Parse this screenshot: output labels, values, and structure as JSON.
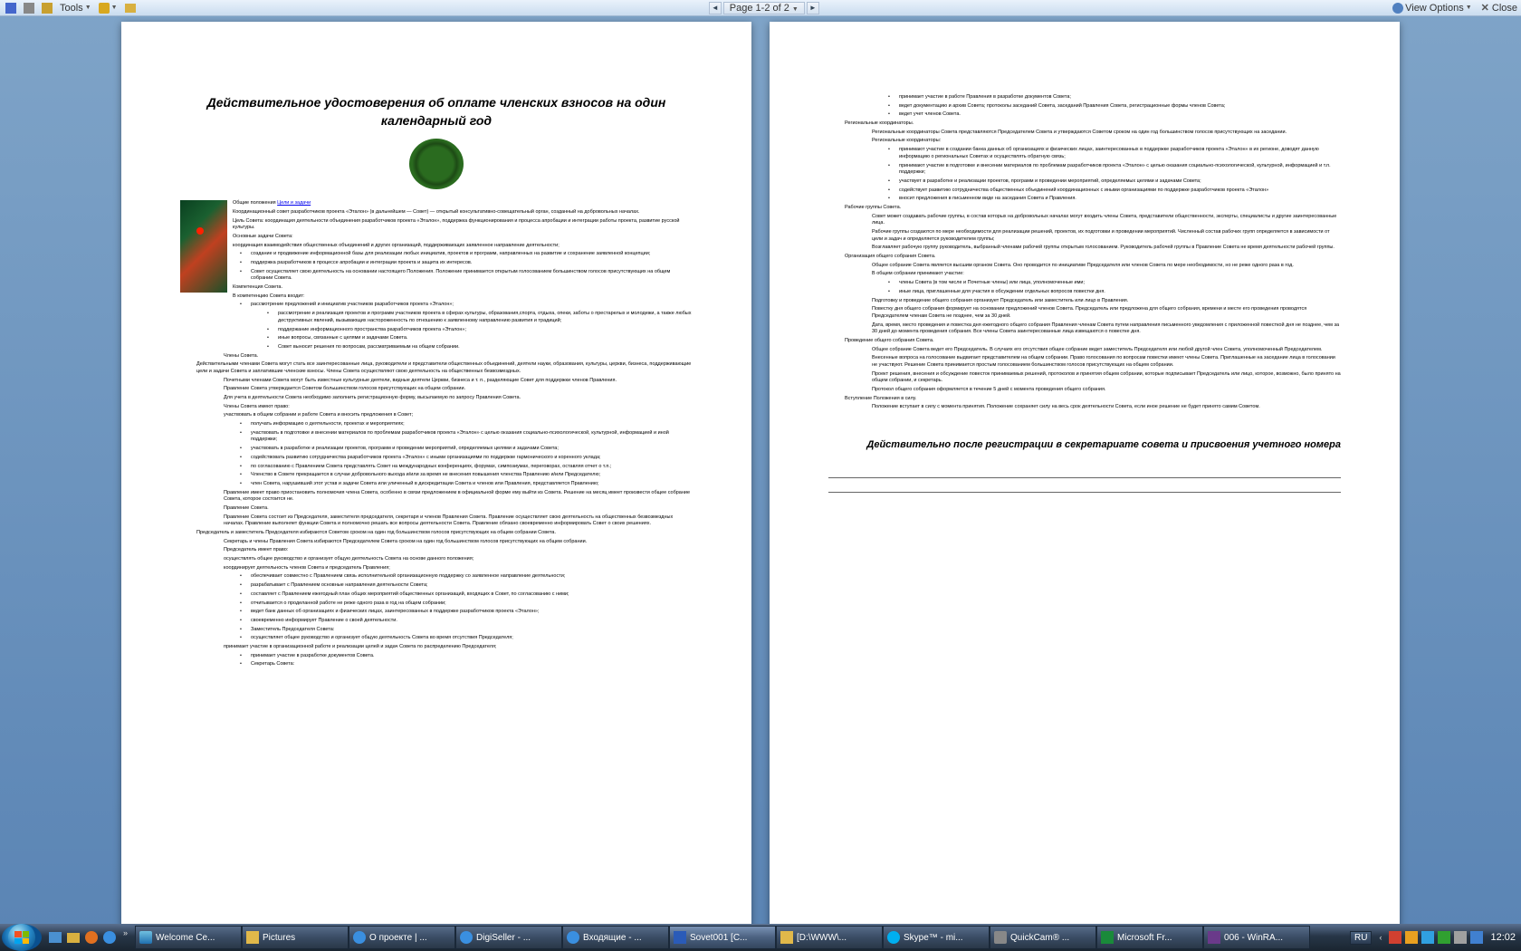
{
  "toolbar": {
    "tools_label": "Tools",
    "view_options_label": "View Options",
    "close_label": "Close",
    "page_label": "Page 1-2 of 2"
  },
  "document": {
    "title": "Действительное удостоверения об оплате членских взносов на один календарный год",
    "link_text": "Цели и задачи",
    "section1_heading": "Общие положения",
    "footer_note": "Действительно после регистрации в секретариате совета и присвоения учетного номера",
    "p1": {
      "items": [
        "Координационный совет разработчиков проекта «Эталон» (в дальнейшем — Совет) — открытый консультативно-совещательный орган, созданный на добровольных началах.",
        "Цель Совета: координация деятельности объединения разработчиков проекта «Эталон», поддержка функционирования и процесса апробации и интеграции работы проекта, развитие русской культуры.",
        "Основные задачи Совета:",
        "координация взаимодействия общественных объединений и других организаций, поддерживающих заявленное направление деятельности;",
        "создание и продвижение информационной базы для реализации любых инициатив, проектов и программ, направленных на развитие и сохранение заявленной концепции;",
        "поддержка разработчиков в процессе апробации и интеграции проекта и защита их интересов.",
        "Совет осуществляет свою деятельность на основании настоящего Положения. Положение принимается открытым голосованием большинством голосов присутствующих на общем собрании Совета.",
        "Компетенция Совета.",
        "В компетенцию Совета входит:",
        "рассмотрение предложений и инициатив участников разработчиков проекта «Эталон»;",
        "рассмотрение и реализация проектов и программ участников проекта в сферах культуры, образования,спорта, отдыха, опеки, заботы о престарелых и молодежи, а также любых деструктивных явлений, вызывающих настороженность по отношению к заявленному направлению развития и традиций;",
        "поддержание информационного пространства разработчиков проекта «Эталон»;",
        "иные вопросы, связанные с целями и задачами Совета.",
        "Совет выносит решения по вопросам, рассматриваемым на общем собрании.",
        "Члены Совета.",
        "Действительными членами Совета могут стать все заинтересованные лица, руководители и представители общественных объединений, деятели науки, образования, культуры, церкви, бизнеса, поддерживающие цели и задачи Совета и заплатившие членские взносы. Члены Совета осуществляют свою деятельность на общественных безвозмездных.",
        "Почетными членами Совета могут быть известные культурные деятели, видные деятели Церкви, бизнеса и т. п., разделяющие Совет для поддержки членов Правления.",
        "Правление Совета утверждается Советом большинством голосов присутствующих на общем собрании.",
        "Для учета в деятельности Совета необходимо заполнить регистрационную форму, высылаемую по запросу Правления Совета.",
        "Члены Совета имеют право:",
        "участвовать в общем собрании и работе Совета и вносить предложения в Совет;",
        "получать информацию о деятельности, проектах и мероприятиях;",
        "участвовать в подготовке и внесении материалов по проблемам разработчиков проекта «Эталон» с целью оказания социально-психологической, культурной, информацией и иной поддержки;",
        "участвовать в разработке и реализации проектов, программ и проведении мероприятий, определяемых целями и задачами Совета;",
        "содействовать развитию сотрудничества разработчиков проекта «Эталон» с иными организациями по поддержке гармонического и коренного уклада;",
        "по согласованию с Правлением Совета представлять Совет на международных конференциях, форумах, симпозиумах, переговорах, оставляя отчет о т.п.;",
        "Членство в Совете прекращается в случае добровольного выхода и/или за время не внесения повышения членства Правлению и/или Председателю;",
        "член Совета, нарушивший этот устав и задачи Совета или уличенный в дискредитации Совета и членов или Правления, представляется Правлению;",
        "Правление имеет право приостановить полномочия члена Совета, особенно в связи предложением в официальной форме ему выйти из Совета. Решение на месяц имеет произвести общее собрание Совета, которое состоится не.",
        "Правление Совета.",
        "Правление Совета состоит из Председателя, заместителя председателя, секретаря и членов Правления Совета. Правление осуществляет свою деятельность на общественных безвозмездных началах. Правление выполняет функции Совета и полномочно решать все вопросы деятельности Совета. Правление обязано своевременно информировать Совет о своих решениях.",
        "Председатель и заместитель Председателя избираются Советом сроком на один год большинством голосов присутствующих на общем собрании Совета.",
        "Секретарь и члены Правления Совета избираются Председателем Совета сроком на один год большинством голосов присутствующих на общем собрании.",
        "Председатель имеет право:",
        "осуществлять общее руководство и организует общую деятельность Совета на основе данного положения;",
        "координирует деятельность членов Совета и председатель Правления;",
        "обеспечивает совместно с Правлением связь исполнительной организационную поддержку со заявленное направление деятельности;",
        "разрабатывает с Правлением основные направления деятельности Совета;",
        "составляет с Правлением ежегодный план общих мероприятий общественных организаций, входящих в Совет, по согласованию с ними;",
        "отчитывается о проделанной работе не реже одного раза в год на общем собрании;",
        "ведет банк данных об организациях и физических лицах, заинтересованных в поддержке разработчиков проекта «Эталон»;",
        "своевременно информирует Правление о своей деятельности.",
        "Заместитель Председателя Совета:",
        "осуществляет общее руководство и организует общую деятельность Совета во время отсутствия Председателя;",
        "принимает участие в организационной работе и реализации целей и задач Совета по распределению Председателя;",
        "принимает участие в разработке документов Совета.",
        "Секретарь Совета:"
      ]
    },
    "p2": {
      "items": [
        "принимает участие в работе Правления в разработке документов Совета;",
        "ведет документацию и архив Совета; протоколы заседаний Совета, заседаний Правления Совета, регистрационные формы членов Совета;",
        "ведет учет членов Совета.",
        "Региональные координаторы.",
        "Региональные координаторы Совета представляются Председателем Совета и утверждаются Советом сроком на один год большинством голосов присутствующих на заседании.",
        "Региональные координаторы:",
        "принимают участие в создании банка данных об организациях и физических лицах, заинтересованных в поддержке разработчиков проекта «Эталон» в их регионе, доводят данную информацию о региональных Советах и осуществлять обратную связь;",
        "принимают участие в подготовке и внесении материалов по проблемам разработчиков проекта «Эталон» с целью оказания социально-психологической, культурной, информацией и т.п. поддержки;",
        "участвует в разработке и реализации проектов, программ и проведении мероприятий, определяемых целями и задачами Совета;",
        "содействует развитию сотрудничества общественных объединений координационных с иными организациями по поддержке разработчиков проекта «Эталон»",
        "вносит предложения в письменном виде на заседания Совета и Правления.",
        "Рабочие группы Совета.",
        "Совет может создавать рабочие группы, в состав которых на добровольных началах могут входить члены Совета, представители общественности, эксперты, специалисты и другие заинтересованные лица.",
        "Рабочие группы создаются по мере необходимости для реализации решений, проектов, их подготовки и проведении мероприятий. Численный состав рабочих групп определяется в зависимости от цели и задач и определяется руководителем группы;",
        "Возглавляет рабочую группу руководитель, выбранный членами рабочей группы открытым голосованием. Руководитель рабочей группы в Правление Совета не время деятельности рабочей группы.",
        "Организация общего собрания Совета.",
        "Общее собрание Совета является высшим органом Совета. Оно проводится по инициативе Председателя или членов Совета по мере необходимости, но не реже одного раза в год.",
        "В общем собрании принимают участие:",
        "члены Совета (в том числе и Почетные члены) или лица, уполномоченные ими;",
        "иные лица, приглашенные для участия в обсуждении отдельных вопросов повестки дня.",
        "Подготовку и проведение общего собрания организует Председатель или заместитель или лицо в Правления.",
        "Повестку дня общего собрания формирует на основании предложений членов Совета. Председатель или предложена для общего собрания, времени и месте его проведения проводятся Председателем членам Совета не позднее, чем за 30 дней.",
        "Дата, время, место проведения и повестка дня ежегодного общего собрания Правления членам Совета путем направления письменного уведомления с приложенной повесткой дня не позднее, чем за 30 дней до момента проведения собрания. Все члены Совета заинтересованные лица извещаются о повестке дня.",
        "Проведение общего собрания Совета.",
        "Общее собрание Совета ведет его Председатель. В случаях его отсутствия общее собрание ведет заместитель Председателя или любой другой член Совета, уполномоченный Председателем.",
        "Внесенные вопроса на голосование выдвигает представителем на общем собрании. Право голосования по вопросам повестки имеют члены Совета. Приглашенные на заседание лица в голосовании не участвуют. Решение Совета принимается простым голосованием большинством голосов присутствующих на общем собрании.",
        "Проект решения, внесения и обсуждение повесток принимаемых решений, протоколов и принятия общем собрании, которые подписывает Председатель или лицо, которое, возможно, было принято на общем собрании, и секретарь.",
        "Протокол общего собрания оформляется в течение 5 дней с момента проведения общего собрания.",
        "Вступление Положения в силу.",
        "Положение вступает в силу с момента принятия. Положение сохраняет силу на весь срок деятельности Совета, если иное решение не будет принято самим Советом."
      ]
    }
  },
  "taskbar": {
    "items": [
      {
        "icon": "win",
        "label": "Welcome Ce..."
      },
      {
        "icon": "fold",
        "label": "Pictures"
      },
      {
        "icon": "ie",
        "label": "О проекте | ..."
      },
      {
        "icon": "ie",
        "label": "DigiSeller - ..."
      },
      {
        "icon": "ie",
        "label": "Входящие - ..."
      },
      {
        "icon": "word",
        "label": "Sovet001 [C..."
      },
      {
        "icon": "fold",
        "label": "[D:\\WWW\\..."
      },
      {
        "icon": "skype",
        "label": "Skype™ - mi..."
      },
      {
        "icon": "cam",
        "label": "QuickCam® ..."
      },
      {
        "icon": "fp",
        "label": "Microsoft Fr..."
      },
      {
        "icon": "rar",
        "label": "006 - WinRA..."
      }
    ],
    "lang": "RU",
    "clock": "12:02"
  }
}
